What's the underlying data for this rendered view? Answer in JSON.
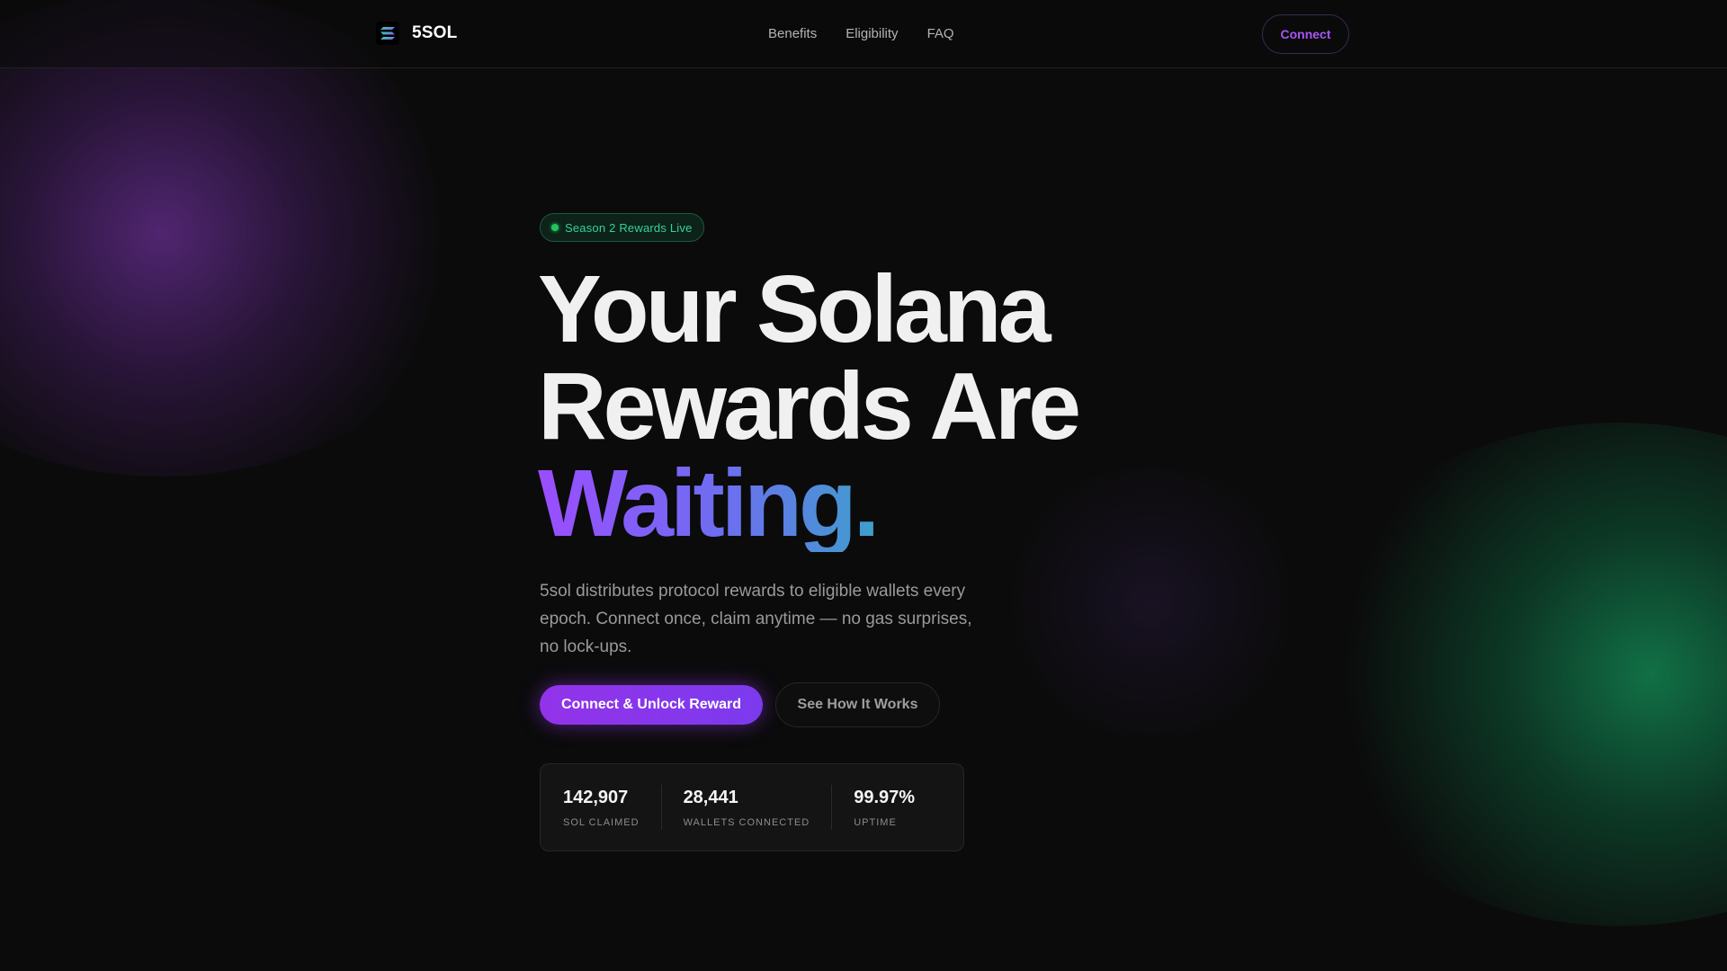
{
  "nav": {
    "brand_name": "5SOL",
    "links": [
      "Benefits",
      "Eligibility",
      "FAQ"
    ],
    "connect_label": "Connect"
  },
  "hero": {
    "badge": "Season 2 Rewards Live",
    "headline_line1": "Your Solana",
    "headline_line2": "Rewards Are",
    "headline_line3": "Waiting.",
    "subtext": "5sol distributes protocol rewards to eligible wallets every epoch. Connect once, claim anytime — no gas surprises, no lock-ups.",
    "primary_cta": "Connect & Unlock Reward",
    "secondary_cta": "See How It Works"
  },
  "stats": [
    {
      "value": "142,907",
      "label": "SOL CLAIMED"
    },
    {
      "value": "28,441",
      "label": "WALLETS CONNECTED"
    },
    {
      "value": "99.97%",
      "label": "UPTIME"
    }
  ],
  "colors": {
    "accent_purple": "#a855f7",
    "accent_green": "#22c55e",
    "background": "#0b0b0b"
  },
  "icons": {
    "brand_logo": "solana-logo-icon",
    "badge_dot": "status-dot-icon"
  }
}
